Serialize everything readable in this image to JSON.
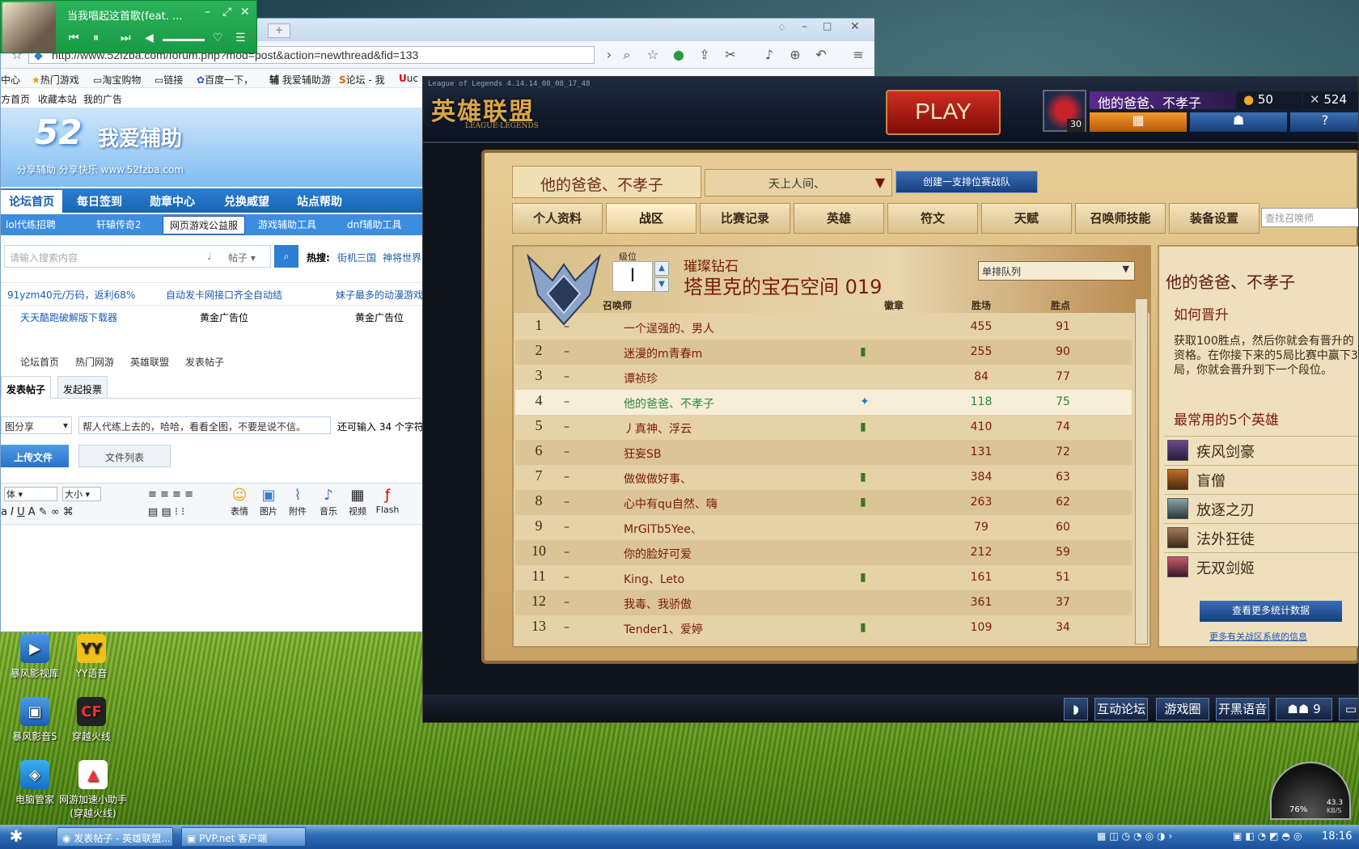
{
  "music": {
    "title": "当我唱起这首歌(feat. ...",
    "controls": [
      "prev",
      "pause",
      "next",
      "volume",
      "like",
      "list"
    ]
  },
  "browser": {
    "url": "http://www.52fzba.com/forum.php?mod=post&action=newthread&fid=133",
    "favorites": [
      "中心",
      "热门游戏",
      "淘宝购物",
      "链接",
      "百度一下，",
      "我爱辅助游",
      "论坛 - 我",
      "uc"
    ],
    "links": [
      "方首页",
      "收藏本站",
      "我的广告"
    ],
    "site_logo": "52",
    "site_name": "我爱辅助",
    "site_slogan": "分享辅助  分享快乐  www.52fzba.com",
    "nav": [
      "论坛首页",
      "每日签到",
      "勋章中心",
      "兑换威望",
      "站点帮助"
    ],
    "subnav": [
      "lol代练招聘",
      "轩辕传奇2",
      "网页游戏公益服",
      "游戏辅助工具",
      "dnf辅助工具"
    ],
    "search_placeholder": "请输入搜索内容",
    "search_scope": "帖子",
    "hot_label": "热搜:",
    "hot": [
      "街机三国",
      "神将世界"
    ],
    "ads_row1": [
      "91yzm40元/万码，返利68%",
      "自动发卡网接口齐全自动结",
      "妹子最多的动漫游戏"
    ],
    "ads_row2": [
      "天天酷跑破解版下载器",
      "黄金广告位",
      "黄金广告位"
    ],
    "crumbs": [
      "论坛首页",
      "热门网游",
      "英雄联盟",
      "发表帖子"
    ],
    "post_tabs": [
      "发表帖子",
      "发起投票"
    ],
    "category": "图分享",
    "subject": "帮人代练上去的，哈哈，看看全图，不要是说不信。",
    "chars_left": "还可输入 34 个字符",
    "upload": "上传文件",
    "filelist": "文件列表",
    "font": "体",
    "size": "大小",
    "editor_tools": [
      "表情",
      "图片",
      "附件",
      "音乐",
      "视频",
      "Flash"
    ]
  },
  "desktop_icons": [
    "暴风影视库",
    "YY语音",
    "暴风影音5",
    "穿越火线",
    "电脑管家",
    "网游加速小助手(穿越火线)"
  ],
  "lol": {
    "version": "League of Legends 4.14.14_08_08_17_48",
    "logo": "英雄联盟",
    "logo_sub": "LEAGUE·LEGENDS",
    "play": "PLAY",
    "level": "30",
    "summoner": "他的爸爸、不孝子",
    "rp": "50",
    "ip": "524",
    "tab_name": "他的爸爸、不孝子",
    "team_select": "天上人间、",
    "create_team": "创建一支排位赛战队",
    "tabs": [
      "个人资料",
      "战区",
      "比赛记录",
      "英雄",
      "符文",
      "天赋",
      "召唤师技能",
      "装备设置"
    ],
    "active_tab": "战区",
    "find_placeholder": "查找召唤师",
    "level_label": "级位",
    "level_value": "I",
    "tier": "璀璨钻石",
    "division": "塔里克的宝石空间 019",
    "queue": "单排队列",
    "cols": {
      "summoner": "召唤师",
      "badge": "徽章",
      "wins": "胜场",
      "lp": "胜点"
    },
    "rows": [
      {
        "rank": "1",
        "dash": "–",
        "name": "一个逞强的、男人",
        "badge": "",
        "wins": "455",
        "lp": "91"
      },
      {
        "rank": "2",
        "dash": "–",
        "name": "迷漫的m青春m",
        "badge": "▮",
        "wins": "255",
        "lp": "90"
      },
      {
        "rank": "3",
        "dash": "–",
        "name": "谭祯珍",
        "badge": "",
        "wins": "84",
        "lp": "77"
      },
      {
        "rank": "4",
        "dash": "–",
        "name": "他的爸爸、不孝子",
        "badge": "✦",
        "wins": "118",
        "lp": "75"
      },
      {
        "rank": "5",
        "dash": "–",
        "name": "丿真神、浮云",
        "badge": "▮",
        "wins": "410",
        "lp": "74"
      },
      {
        "rank": "6",
        "dash": "–",
        "name": "狂妄SB",
        "badge": "",
        "wins": "131",
        "lp": "72"
      },
      {
        "rank": "7",
        "dash": "–",
        "name": "做做做好事、",
        "badge": "▮",
        "wins": "384",
        "lp": "63"
      },
      {
        "rank": "8",
        "dash": "–",
        "name": "心中有qu自然、嗨",
        "badge": "▮",
        "wins": "263",
        "lp": "62"
      },
      {
        "rank": "9",
        "dash": "–",
        "name": "MrGlTb5Yee、",
        "badge": "",
        "wins": "79",
        "lp": "60"
      },
      {
        "rank": "10",
        "dash": "–",
        "name": "你的脸好可爱",
        "badge": "",
        "wins": "212",
        "lp": "59"
      },
      {
        "rank": "11",
        "dash": "–",
        "name": "King、Leto",
        "badge": "▮",
        "wins": "161",
        "lp": "51"
      },
      {
        "rank": "12",
        "dash": "–",
        "name": "我毒、我骄傲",
        "badge": "",
        "wins": "361",
        "lp": "37"
      },
      {
        "rank": "13",
        "dash": "–",
        "name": "Tender1、爱婷",
        "badge": "▮",
        "wins": "109",
        "lp": "34"
      }
    ],
    "side": {
      "name": "他的爸爸、不孝子",
      "promo_title": "如何晋升",
      "promo_text": "获取100胜点，然后你就会有晋升的资格。在你接下来的5局比赛中赢下3局，你就会晋升到下一个段位。",
      "champs_title": "最常用的5个英雄",
      "champs": [
        "疾风剑豪",
        "盲僧",
        "放逐之刃",
        "法外狂徒",
        "无双剑姬"
      ],
      "more_stats": "查看更多统计数据",
      "more_link": "更多有关战区系统的信息"
    },
    "bottom": {
      "forum": "互动论坛",
      "circle": "游戏圈",
      "party": "开黑语音",
      "friends": "9"
    }
  },
  "taskbar": {
    "items": [
      "发表帖子 - 英雄联盟...",
      "PVP.net 客户端"
    ],
    "clock": "18:16",
    "gauge_pct": "76%",
    "gauge_speed": "43.3",
    "gauge_unit": "KB/S"
  }
}
